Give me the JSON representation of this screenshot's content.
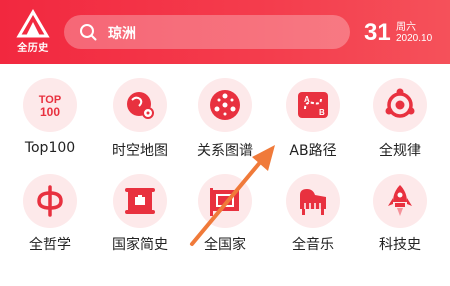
{
  "header": {
    "logo_text": "全历史",
    "search_value": "琼洲",
    "date": {
      "day": "31",
      "weekday": "周六",
      "year_month": "2020.10"
    }
  },
  "grid": {
    "items": [
      {
        "label": "Top100",
        "icon": "top100-icon"
      },
      {
        "label": "时空地图",
        "icon": "map-pin-icon"
      },
      {
        "label": "关系图谱",
        "icon": "graph-network-icon"
      },
      {
        "label": "AB路径",
        "icon": "ab-path-icon"
      },
      {
        "label": "全规律",
        "icon": "pattern-icon"
      },
      {
        "label": "全哲学",
        "icon": "phi-icon"
      },
      {
        "label": "国家简史",
        "icon": "scroll-icon"
      },
      {
        "label": "全国家",
        "icon": "flag-icon"
      },
      {
        "label": "全音乐",
        "icon": "piano-icon"
      },
      {
        "label": "科技史",
        "icon": "rocket-icon"
      }
    ],
    "top100_text": [
      "TOP",
      "100"
    ],
    "ab_text": [
      "A",
      "B"
    ]
  },
  "colors": {
    "header": "#f2283f",
    "icon": "#e8313f",
    "icon_bg": "#fde9ea",
    "arrow": "#f07a3a"
  }
}
